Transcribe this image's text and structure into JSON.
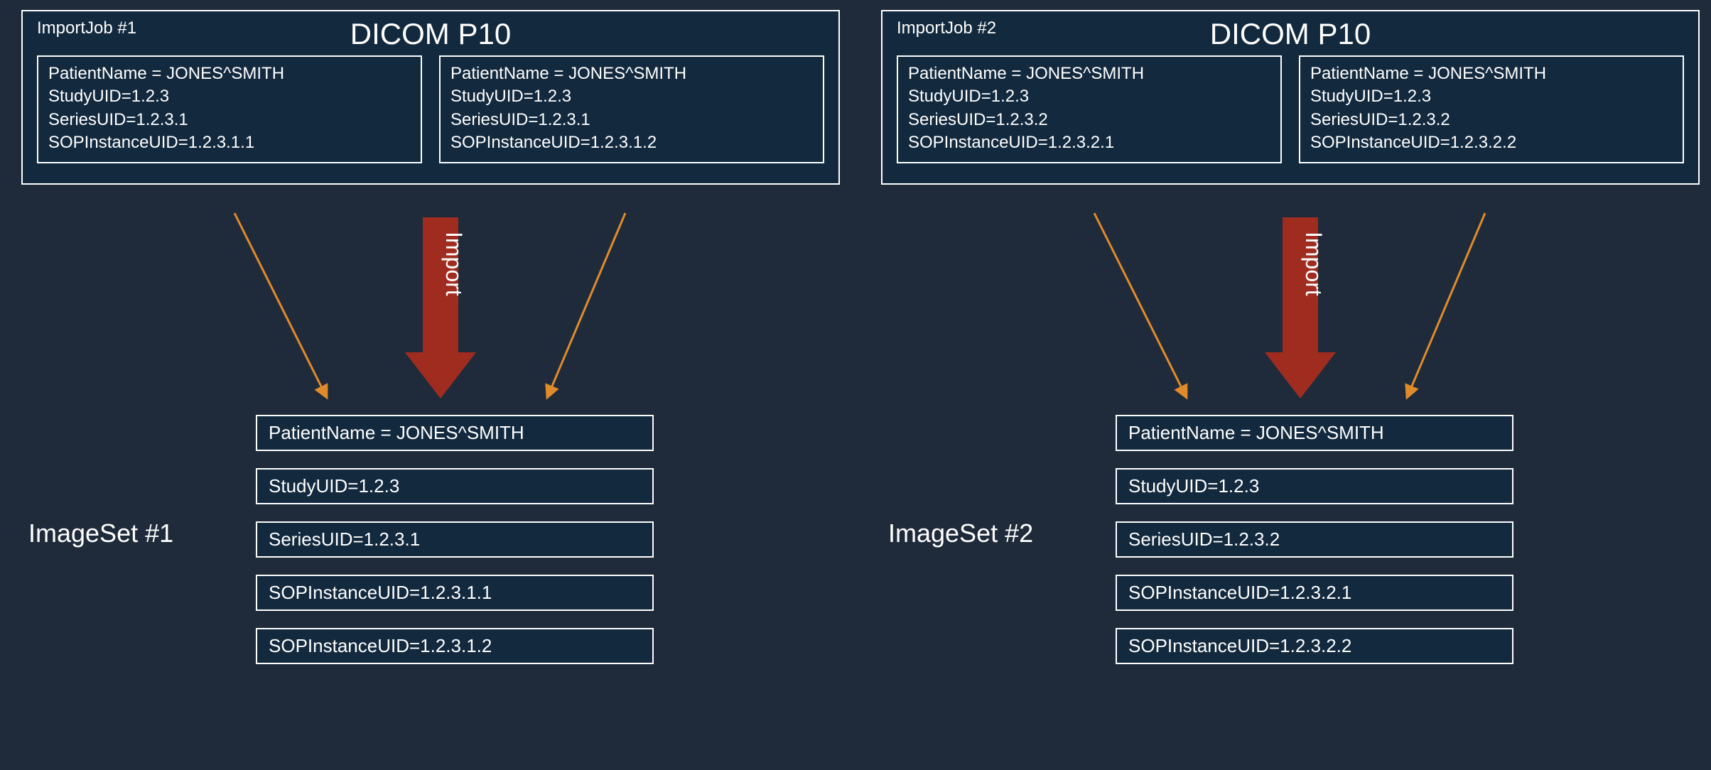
{
  "jobs": [
    {
      "label": "ImportJob #1",
      "title": "DICOM P10",
      "instances": [
        {
          "patient": "PatientName = JONES^SMITH",
          "study": "StudyUID=1.2.3",
          "series": "SeriesUID=1.2.3.1",
          "sop": "SOPInstanceUID=1.2.3.1.1"
        },
        {
          "patient": "PatientName = JONES^SMITH",
          "study": "StudyUID=1.2.3",
          "series": "SeriesUID=1.2.3.1",
          "sop": "SOPInstanceUID=1.2.3.1.2"
        }
      ],
      "importLabel": "Import",
      "imagesetLabel": "ImageSet #1",
      "result": [
        "PatientName = JONES^SMITH",
        "StudyUID=1.2.3",
        "SeriesUID=1.2.3.1",
        "SOPInstanceUID=1.2.3.1.1",
        "SOPInstanceUID=1.2.3.1.2"
      ]
    },
    {
      "label": "ImportJob #2",
      "title": "DICOM P10",
      "instances": [
        {
          "patient": "PatientName = JONES^SMITH",
          "study": "StudyUID=1.2.3",
          "series": "SeriesUID=1.2.3.2",
          "sop": "SOPInstanceUID=1.2.3.2.1"
        },
        {
          "patient": "PatientName = JONES^SMITH",
          "study": "StudyUID=1.2.3",
          "series": "SeriesUID=1.2.3.2",
          "sop": "SOPInstanceUID=1.2.3.2.2"
        }
      ],
      "importLabel": "Import",
      "imagesetLabel": "ImageSet #2",
      "result": [
        "PatientName = JONES^SMITH",
        "StudyUID=1.2.3",
        "SeriesUID=1.2.3.2",
        "SOPInstanceUID=1.2.3.2.1",
        "SOPInstanceUID=1.2.3.2.2"
      ]
    }
  ]
}
